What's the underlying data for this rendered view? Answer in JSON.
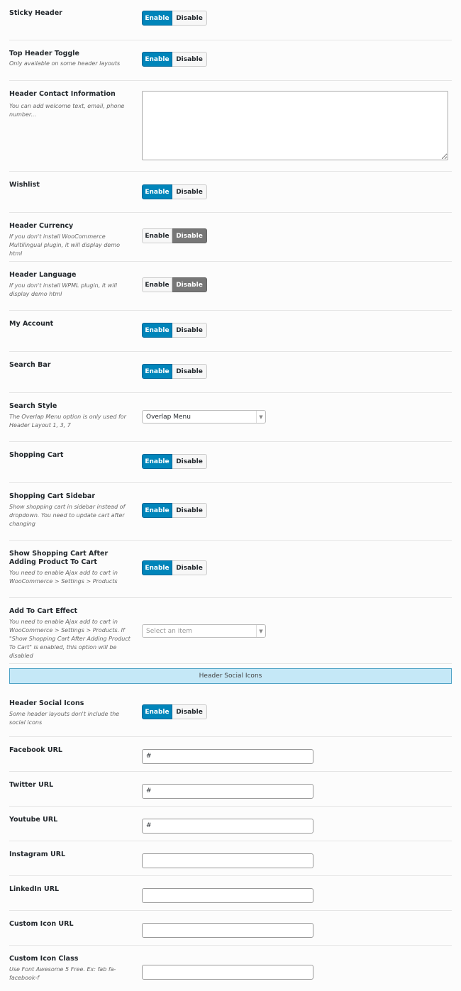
{
  "toggle": {
    "enable": "Enable",
    "disable": "Disable"
  },
  "header_rows": [
    {
      "title": "Sticky Header",
      "desc": "",
      "state": "enable"
    },
    {
      "title": "Top Header Toggle",
      "desc": "Only available on some header layouts",
      "state": "enable"
    }
  ],
  "contact": {
    "title": "Header Contact Information",
    "desc": "You can add welcome text, email, phone number...",
    "value": ""
  },
  "rows2": [
    {
      "title": "Wishlist",
      "desc": "",
      "state": "enable"
    },
    {
      "title": "Header Currency",
      "desc": "If you don't install WooCommerce Multilingual plugin, it will display demo html",
      "state": "disable"
    },
    {
      "title": "Header Language",
      "desc": "If you don't install WPML plugin, it will display demo html",
      "state": "disable"
    },
    {
      "title": "My Account",
      "desc": "",
      "state": "enable"
    },
    {
      "title": "Search Bar",
      "desc": "",
      "state": "enable"
    }
  ],
  "search_style": {
    "title": "Search Style",
    "desc": "The Overlap Menu option is only used for Header Layout 1, 3, 7",
    "value": "Overlap Menu"
  },
  "rows3": [
    {
      "title": "Shopping Cart",
      "desc": "",
      "state": "enable"
    },
    {
      "title": "Shopping Cart Sidebar",
      "desc": "Show shopping cart in sidebar instead of dropdown. You need to update cart after changing",
      "state": "enable"
    },
    {
      "title": "Show Shopping Cart After Adding Product To Cart",
      "desc": "You need to enable Ajax add to cart in WooCommerce > Settings > Products",
      "state": "enable"
    }
  ],
  "add_to_cart": {
    "title": "Add To Cart Effect",
    "desc": "You need to enable Ajax add to cart in WooCommerce > Settings > Products. If \"Show Shopping Cart After Adding Product To Cart\" is enabled, this option will be disabled",
    "placeholder": "Select an item"
  },
  "section": {
    "title": "Header Social Icons"
  },
  "social_toggle": {
    "title": "Header Social Icons",
    "desc": "Some header layouts don't include the social icons",
    "state": "enable"
  },
  "urls": [
    {
      "title": "Facebook URL",
      "desc": "",
      "value": "#"
    },
    {
      "title": "Twitter URL",
      "desc": "",
      "value": "#"
    },
    {
      "title": "Youtube URL",
      "desc": "",
      "value": "#"
    },
    {
      "title": "Instagram URL",
      "desc": "",
      "value": ""
    },
    {
      "title": "LinkedIn URL",
      "desc": "",
      "value": ""
    },
    {
      "title": "Custom Icon URL",
      "desc": "",
      "value": ""
    },
    {
      "title": "Custom Icon Class",
      "desc": "Use Font Awesome 5 Free. Ex: fab fa-facebook-f",
      "value": ""
    }
  ]
}
